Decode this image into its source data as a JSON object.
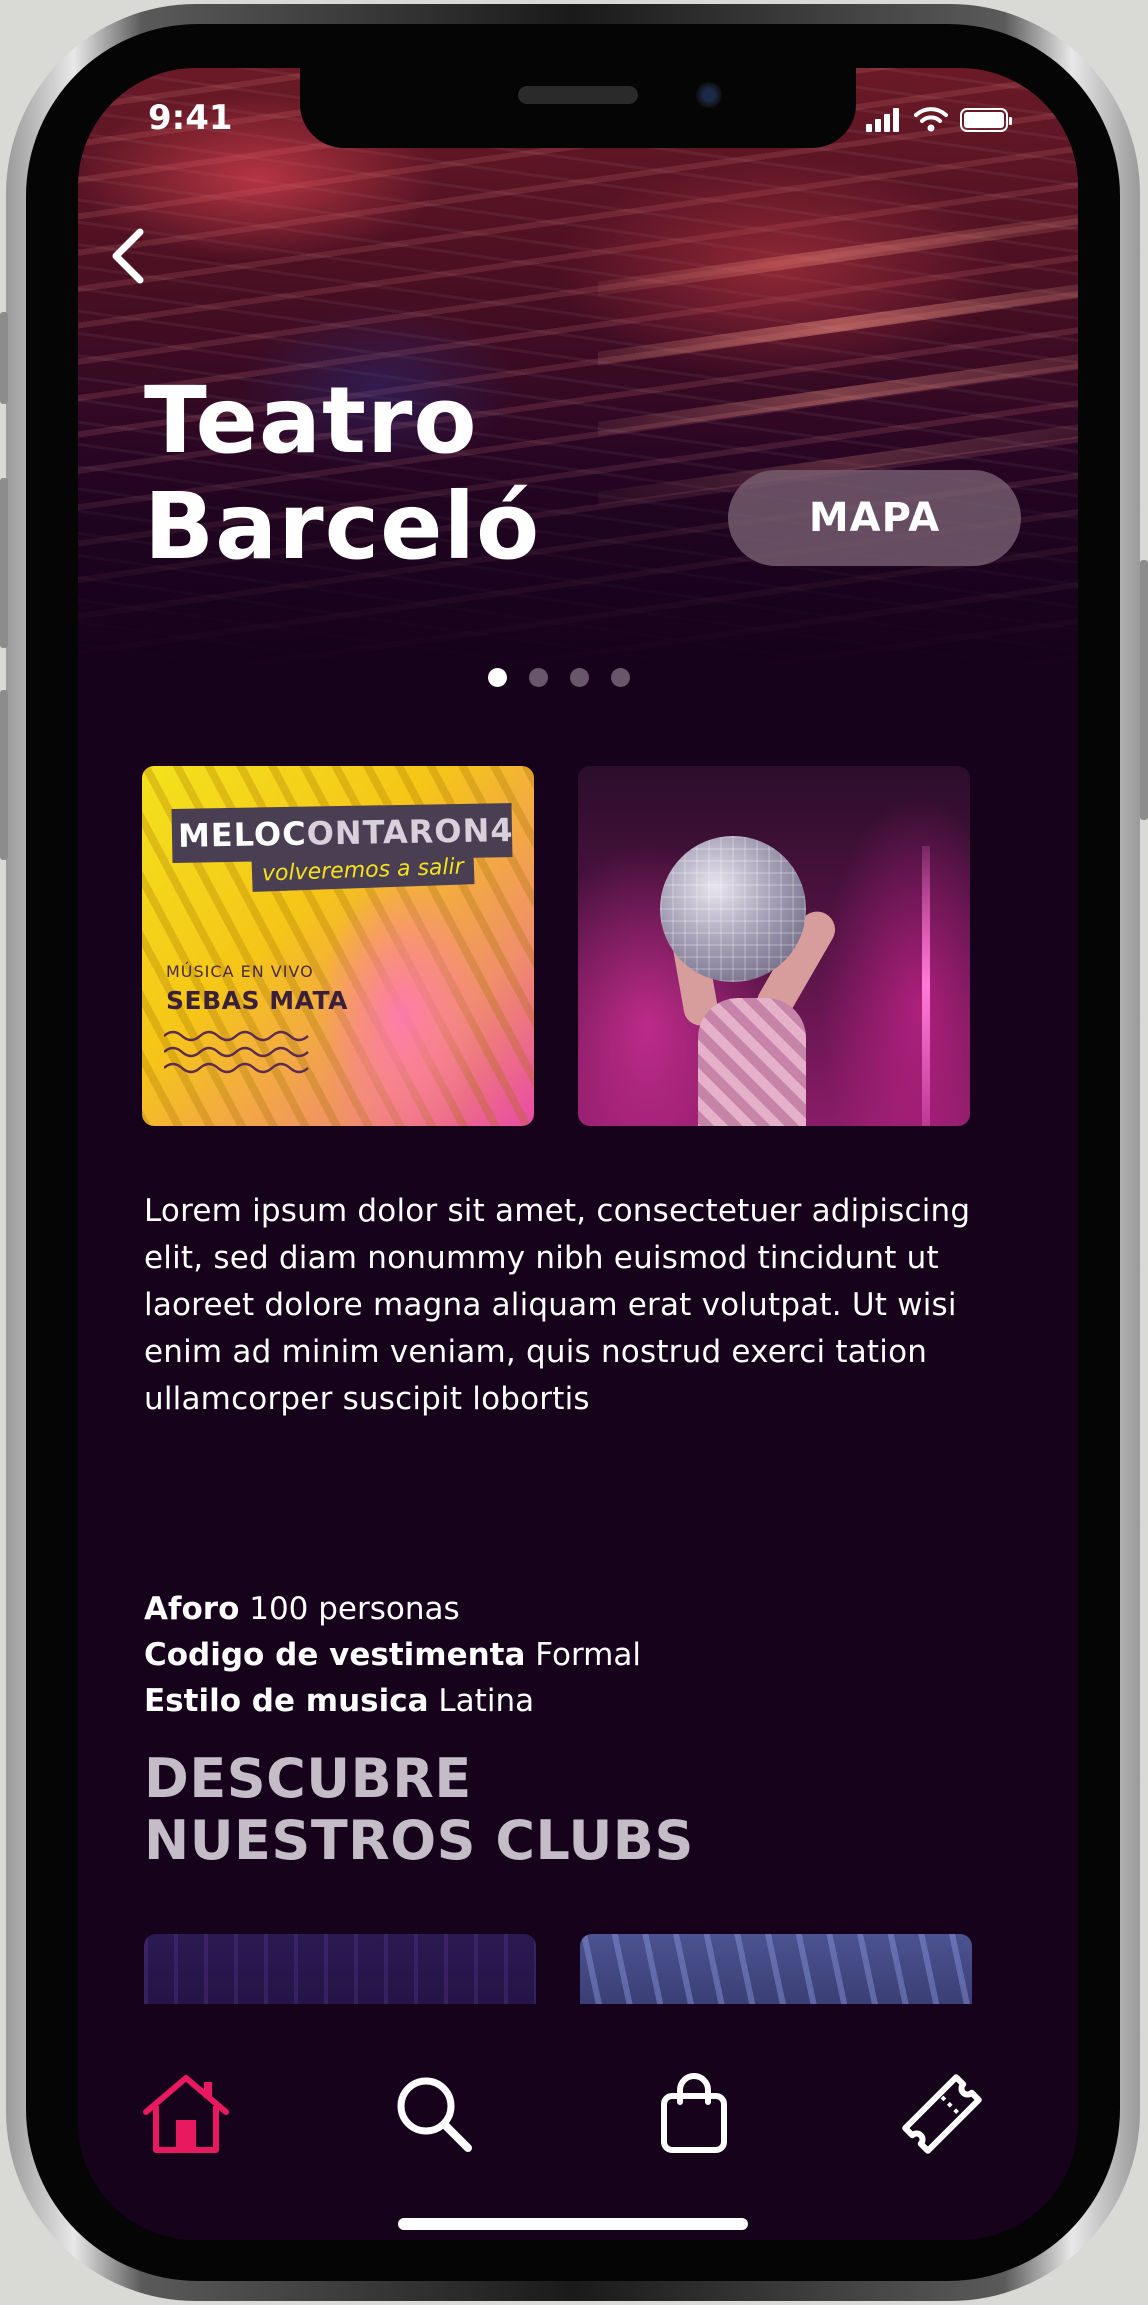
{
  "status_bar": {
    "time": "9:41"
  },
  "hero": {
    "title_line1": "Teatro",
    "title_line2": "Barceló",
    "map_button": "MAPA",
    "carousel": {
      "pages": 4,
      "active_index": 0
    }
  },
  "events": [
    {
      "banner_bold": "MELOC",
      "banner_rest": "ONTARON4",
      "tagline": "volveremos a salir",
      "kicker": "MÚSICA EN VIVO",
      "artist": "SEBAS MATA"
    },
    {
      "image": "disco-ball-dancer"
    }
  ],
  "description": "Lorem ipsum dolor sit amet, consectetuer adipiscing elit, sed diam nonummy nibh euismod tincidunt ut laoreet dolore magna aliquam erat volutpat. Ut wisi enim ad minim veniam, quis nostrud exerci tation ullamcorper suscipit lobortis",
  "details": [
    {
      "label": "Aforo",
      "value": "100 personas"
    },
    {
      "label": "Codigo de vestimenta",
      "value": "Formal"
    },
    {
      "label": "Estilo de musica",
      "value": "Latina"
    }
  ],
  "clubs_section": {
    "title_line1": "DESCUBRE",
    "title_line2": "NUESTROS CLUBS"
  },
  "tab_bar": {
    "items": [
      {
        "icon": "home-icon",
        "active": true
      },
      {
        "icon": "search-icon",
        "active": false
      },
      {
        "icon": "bag-icon",
        "active": false
      },
      {
        "icon": "ticket-icon",
        "active": false
      }
    ]
  },
  "colors": {
    "background": "#17021c",
    "accent": "#e8195f",
    "map_button": "#785e70",
    "dot_inactive": "#68576b",
    "section_title": "#c4bcc6"
  }
}
